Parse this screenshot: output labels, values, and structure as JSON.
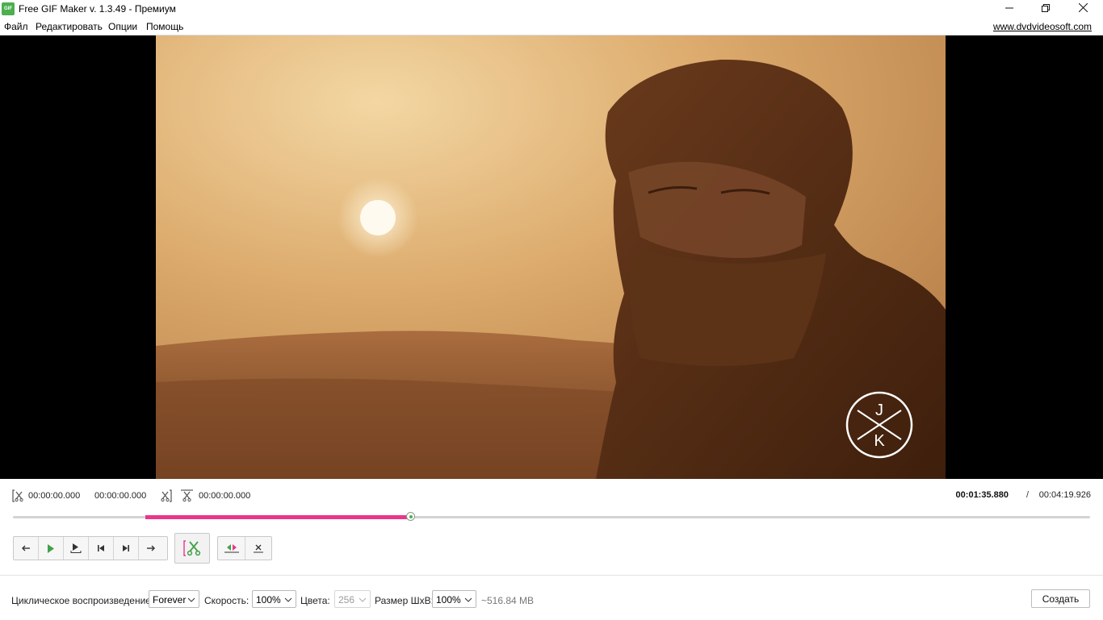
{
  "window": {
    "title": "Free GIF Maker v. 1.3.49 - Премиум",
    "icon_text": "GIF",
    "controls": [
      "minimize-icon",
      "restore-icon",
      "close-icon"
    ]
  },
  "menu": {
    "items": [
      "Файл",
      "Редактировать",
      "Опции",
      "Помощь"
    ],
    "site_link": "www.dvdvideosoft.com"
  },
  "video": {
    "watermark_letters": [
      "J",
      "K"
    ]
  },
  "time": {
    "start": "00:00:00.000",
    "end": "00:00:00.000",
    "clip": "00:00:00.000",
    "current": "00:01:35.880",
    "separator": "/",
    "total": "00:04:19.926"
  },
  "timeline": {
    "selection_start_fraction": 0.123,
    "selection_end_fraction": 0.369,
    "playhead_fraction": 0.369,
    "track_color": "#d3d3d3",
    "selection_color": "#e8378c"
  },
  "controls": {
    "playback": [
      "step-back-icon",
      "play-icon",
      "play-to-mark-icon",
      "go-start-icon",
      "go-end-icon",
      "step-forward-icon"
    ],
    "cut": "cut-icon",
    "edit": [
      "merge-fragments-icon",
      "delete-fragment-icon"
    ]
  },
  "settings": {
    "loop_label": "Циклическое воспроизведение:",
    "loop_value": "Forever",
    "speed_label": "Скорость:",
    "speed_value": "100%",
    "colors_label": "Цвета:",
    "colors_value": "256",
    "size_label": "Размер ШхВ:",
    "size_value": "100%",
    "size_estimate": "~516.84 MB"
  },
  "actions": {
    "create_label": "Создать"
  },
  "colors": {
    "accent_pink": "#e8378c",
    "accent_green": "#4caf50"
  }
}
